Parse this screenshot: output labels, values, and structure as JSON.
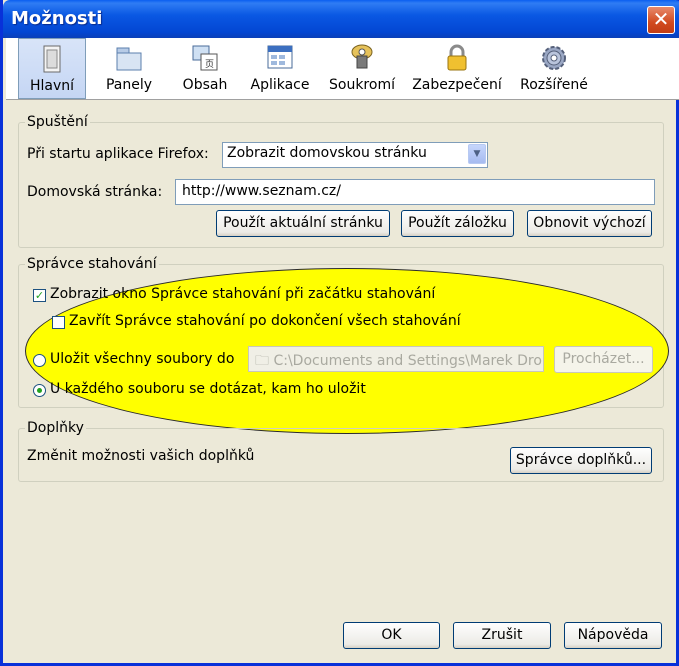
{
  "window": {
    "title": "Možnosti",
    "close_glyph": "✕"
  },
  "toolbar": [
    {
      "label": "Hlavní",
      "icon": "main-icon",
      "selected": true
    },
    {
      "label": "Panely",
      "icon": "tabs-icon"
    },
    {
      "label": "Obsah",
      "icon": "content-icon"
    },
    {
      "label": "Aplikace",
      "icon": "applications-icon"
    },
    {
      "label": "Soukromí",
      "icon": "privacy-icon"
    },
    {
      "label": "Zabezpečení",
      "icon": "security-icon"
    },
    {
      "label": "Rozšířené",
      "icon": "advanced-icon"
    }
  ],
  "startup": {
    "legend": "Spuštění",
    "when_starts_label": "Při startu aplikace Firefox:",
    "when_starts_value": "Zobrazit domovskou stránku",
    "home_label": "Domovská stránka:",
    "home_value": "http://www.seznam.cz/",
    "use_current": "Použít aktuální stránku",
    "use_bookmark": "Použít záložku",
    "restore_default": "Obnovit výchozí"
  },
  "downloads": {
    "legend": "Správce stahování",
    "show_window_label": "Zobrazit okno Správce stahování při začátku stahování",
    "show_window_checked": true,
    "close_when_done_label": "Zavřít Správce stahování po dokončení všech stahování",
    "close_when_done_checked": false,
    "save_to_label": "Uložit všechny soubory do",
    "save_to_path": "C:\\Documents and Settings\\Marek Dro",
    "browse": "Procházet...",
    "ask_label": "U každého souboru se dotázat, kam ho uložit",
    "selected_option": "ask"
  },
  "addons": {
    "legend": "Doplňky",
    "description": "Změnit možnosti vašich doplňků",
    "manage": "Správce doplňků..."
  },
  "footer": {
    "ok": "OK",
    "cancel": "Zrušit",
    "help": "Nápověda"
  },
  "colors": {
    "highlight": "#ffff00",
    "titlebar": "#0a58e3"
  }
}
